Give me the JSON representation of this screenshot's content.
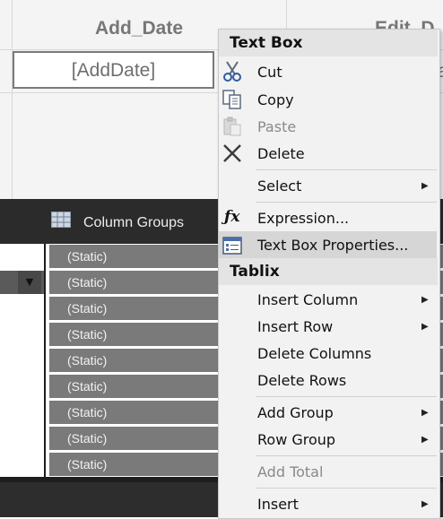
{
  "report": {
    "col1_header": "Add_Date",
    "col2_header": "Edit_D",
    "col1_field": "[AddDate]",
    "col2_field_fragment": "a"
  },
  "grouping": {
    "column_groups_label": "Column Groups",
    "static_rows": [
      "(Static)",
      "(Static)",
      "(Static)",
      "(Static)",
      "(Static)",
      "(Static)",
      "(Static)",
      "(Static)",
      "(Static)"
    ]
  },
  "menu": {
    "textbox_header": "Text Box",
    "cut": "Cut",
    "copy": "Copy",
    "paste": "Paste",
    "delete": "Delete",
    "select": "Select",
    "expression": "Expression...",
    "textbox_properties": "Text Box Properties...",
    "tablix_header": "Tablix",
    "insert_column": "Insert Column",
    "insert_row": "Insert Row",
    "delete_columns": "Delete Columns",
    "delete_rows": "Delete Rows",
    "add_group": "Add Group",
    "row_group": "Row Group",
    "add_total": "Add Total",
    "insert": "Insert"
  },
  "icons": {
    "cut": "scissors-icon",
    "copy": "copy-icon",
    "paste": "paste-icon",
    "delete": "delete-x-icon",
    "expression": "fx-icon",
    "properties": "properties-icon",
    "column_groups": "grid-icon",
    "submenu": "chevron-right-icon",
    "dropdown": "chevron-down-icon"
  },
  "colors": {
    "highlight_underline": "#e0001b",
    "static_bg": "#7a7a7a",
    "pane_bg": "#1e1e1e",
    "menu_bg": "#f2f2f2"
  }
}
